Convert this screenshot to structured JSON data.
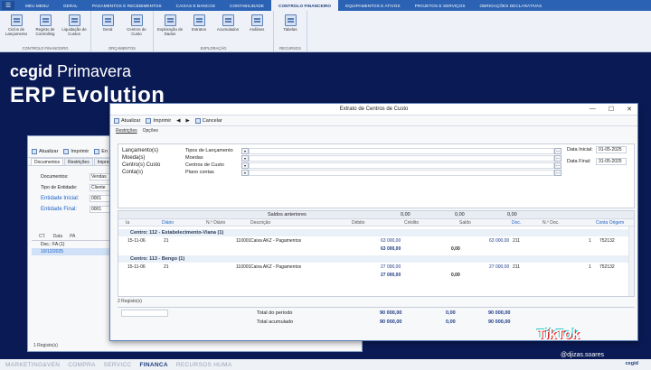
{
  "ribbon": {
    "app_icon": "menu-icon",
    "tabs": [
      "MEU MENU",
      "GERAL",
      "PAGAMENTOS E RECEBIMENTOS",
      "CAIXAS E BANCOS",
      "CONTABILIDADE",
      "CONTROLO FINANCEIRO",
      "EQUIPAMENTOS E ATIVOS",
      "PROJETOS E SERVIÇOS",
      "OBRIGAÇÕES DECLARATIVAS"
    ],
    "active_tab": 5,
    "groups": [
      {
        "title": "CONTROLO FINANCEIRO",
        "buttons": [
          "Ciclos de Lançamento",
          "Registo de Controlling",
          "Liquidação de Custos"
        ]
      },
      {
        "title": "ORÇAMENTOS",
        "buttons": [
          "Geral",
          "Centros de Custo"
        ]
      },
      {
        "title": "EXPLORAÇÃO",
        "buttons": [
          "Exploração de Dados",
          "Extratos",
          "Acumulados",
          "Análises"
        ]
      },
      {
        "title": "RECURSOS",
        "buttons": [
          "Tabelas"
        ]
      }
    ]
  },
  "brand": {
    "cegid": "cegid",
    "primavera": "Primavera",
    "erp": "ERP Evolution"
  },
  "back_window": {
    "toolbar": [
      "Atualizar",
      "Imprimir",
      "En"
    ],
    "tabs": [
      "Documentos",
      "Restrições",
      "Impressão"
    ],
    "fields": [
      {
        "label": "Documentos:",
        "value": "Vendas"
      },
      {
        "label": "Tipo de Entidade:",
        "value": "Cliente"
      },
      {
        "label": "Entidade Inicial:",
        "value": "0001"
      },
      {
        "label": "Entidade Final:",
        "value": "0001"
      }
    ],
    "grid_headers": [
      "CT.",
      "Data",
      "PA"
    ],
    "grid_group": "Doc.: FA (1)",
    "grid_row": "10/12/2025",
    "status": "1 Registo(s)"
  },
  "front_window": {
    "title": "Extrato de Centros de Custo",
    "controls": [
      "—",
      "☐",
      "✕"
    ],
    "toolbar": [
      "Atualizar",
      "Imprimir",
      "Cancelar"
    ],
    "tabs": [
      "Restrições",
      "Opções"
    ],
    "criteria": [
      {
        "label": "Lançamento(s)",
        "name": "Tipos de Lançamento"
      },
      {
        "label": "Moeda(s)",
        "name": "Moedas"
      },
      {
        "label": "Centro(s) Custo",
        "name": "Centros de Custo"
      },
      {
        "label": "Conta(s)",
        "name": "Plano contas"
      }
    ],
    "date_start_label": "Data Inicial:",
    "date_start": "01-05-2025",
    "date_end_label": "Data Final:",
    "date_end": "31-05-2025",
    "saldos_label": "Saldos anteriores",
    "saldos_values": [
      "0,00",
      "0,00",
      "0,00"
    ],
    "columns": [
      "Ia",
      "Diário",
      "N.º Diário",
      "Descrição",
      "Débito",
      "Crédito",
      "Saldo",
      "Doc.",
      "N.º Doc.",
      "Conta Origem"
    ],
    "groups": [
      {
        "title": "Centro: 112 - Estabelecimento-Viana (1)",
        "row": {
          "date": "15-11-06",
          "diario": "21",
          "num": "110001",
          "desc": "Caixa AKZ - Pagamentos",
          "debito": "",
          "credito": "63 000,00",
          "saldo": "63 000,00",
          "doc": "211",
          "ndoc": "1",
          "origem": "752132"
        },
        "subtotal": {
          "credito": "63 000,00",
          "saldo": "0,00"
        }
      },
      {
        "title": "Centro: 113 - Bengo (1)",
        "row": {
          "date": "15-11-06",
          "diario": "21",
          "num": "110001",
          "desc": "Caixa AKZ - Pagamentos",
          "debito": "",
          "credito": "27 000,00",
          "saldo": "27 000,00",
          "doc": "211",
          "ndoc": "1",
          "origem": "752132"
        },
        "subtotal": {
          "credito": "27 000,00",
          "saldo": "0,00"
        }
      }
    ],
    "registos": "2 Registo(s)",
    "totals": [
      {
        "label": "Total do período",
        "debito": "",
        "credito": "90 000,00",
        "saldo": "90 000,00"
      },
      {
        "label": "Total acumulado",
        "debito": "",
        "credito": "90 000,00",
        "saldo": "90 000,00"
      }
    ],
    "totals_zero": "0,00"
  },
  "modules": [
    "MARKETING&VEN",
    "COMPRA",
    "SERVICC",
    "FINANCA",
    "RECURSOS HUMA"
  ],
  "active_module": 3,
  "modules_brand": "cegid",
  "watermark": {
    "logo": "TikTok",
    "user": "@djizas.soares"
  }
}
